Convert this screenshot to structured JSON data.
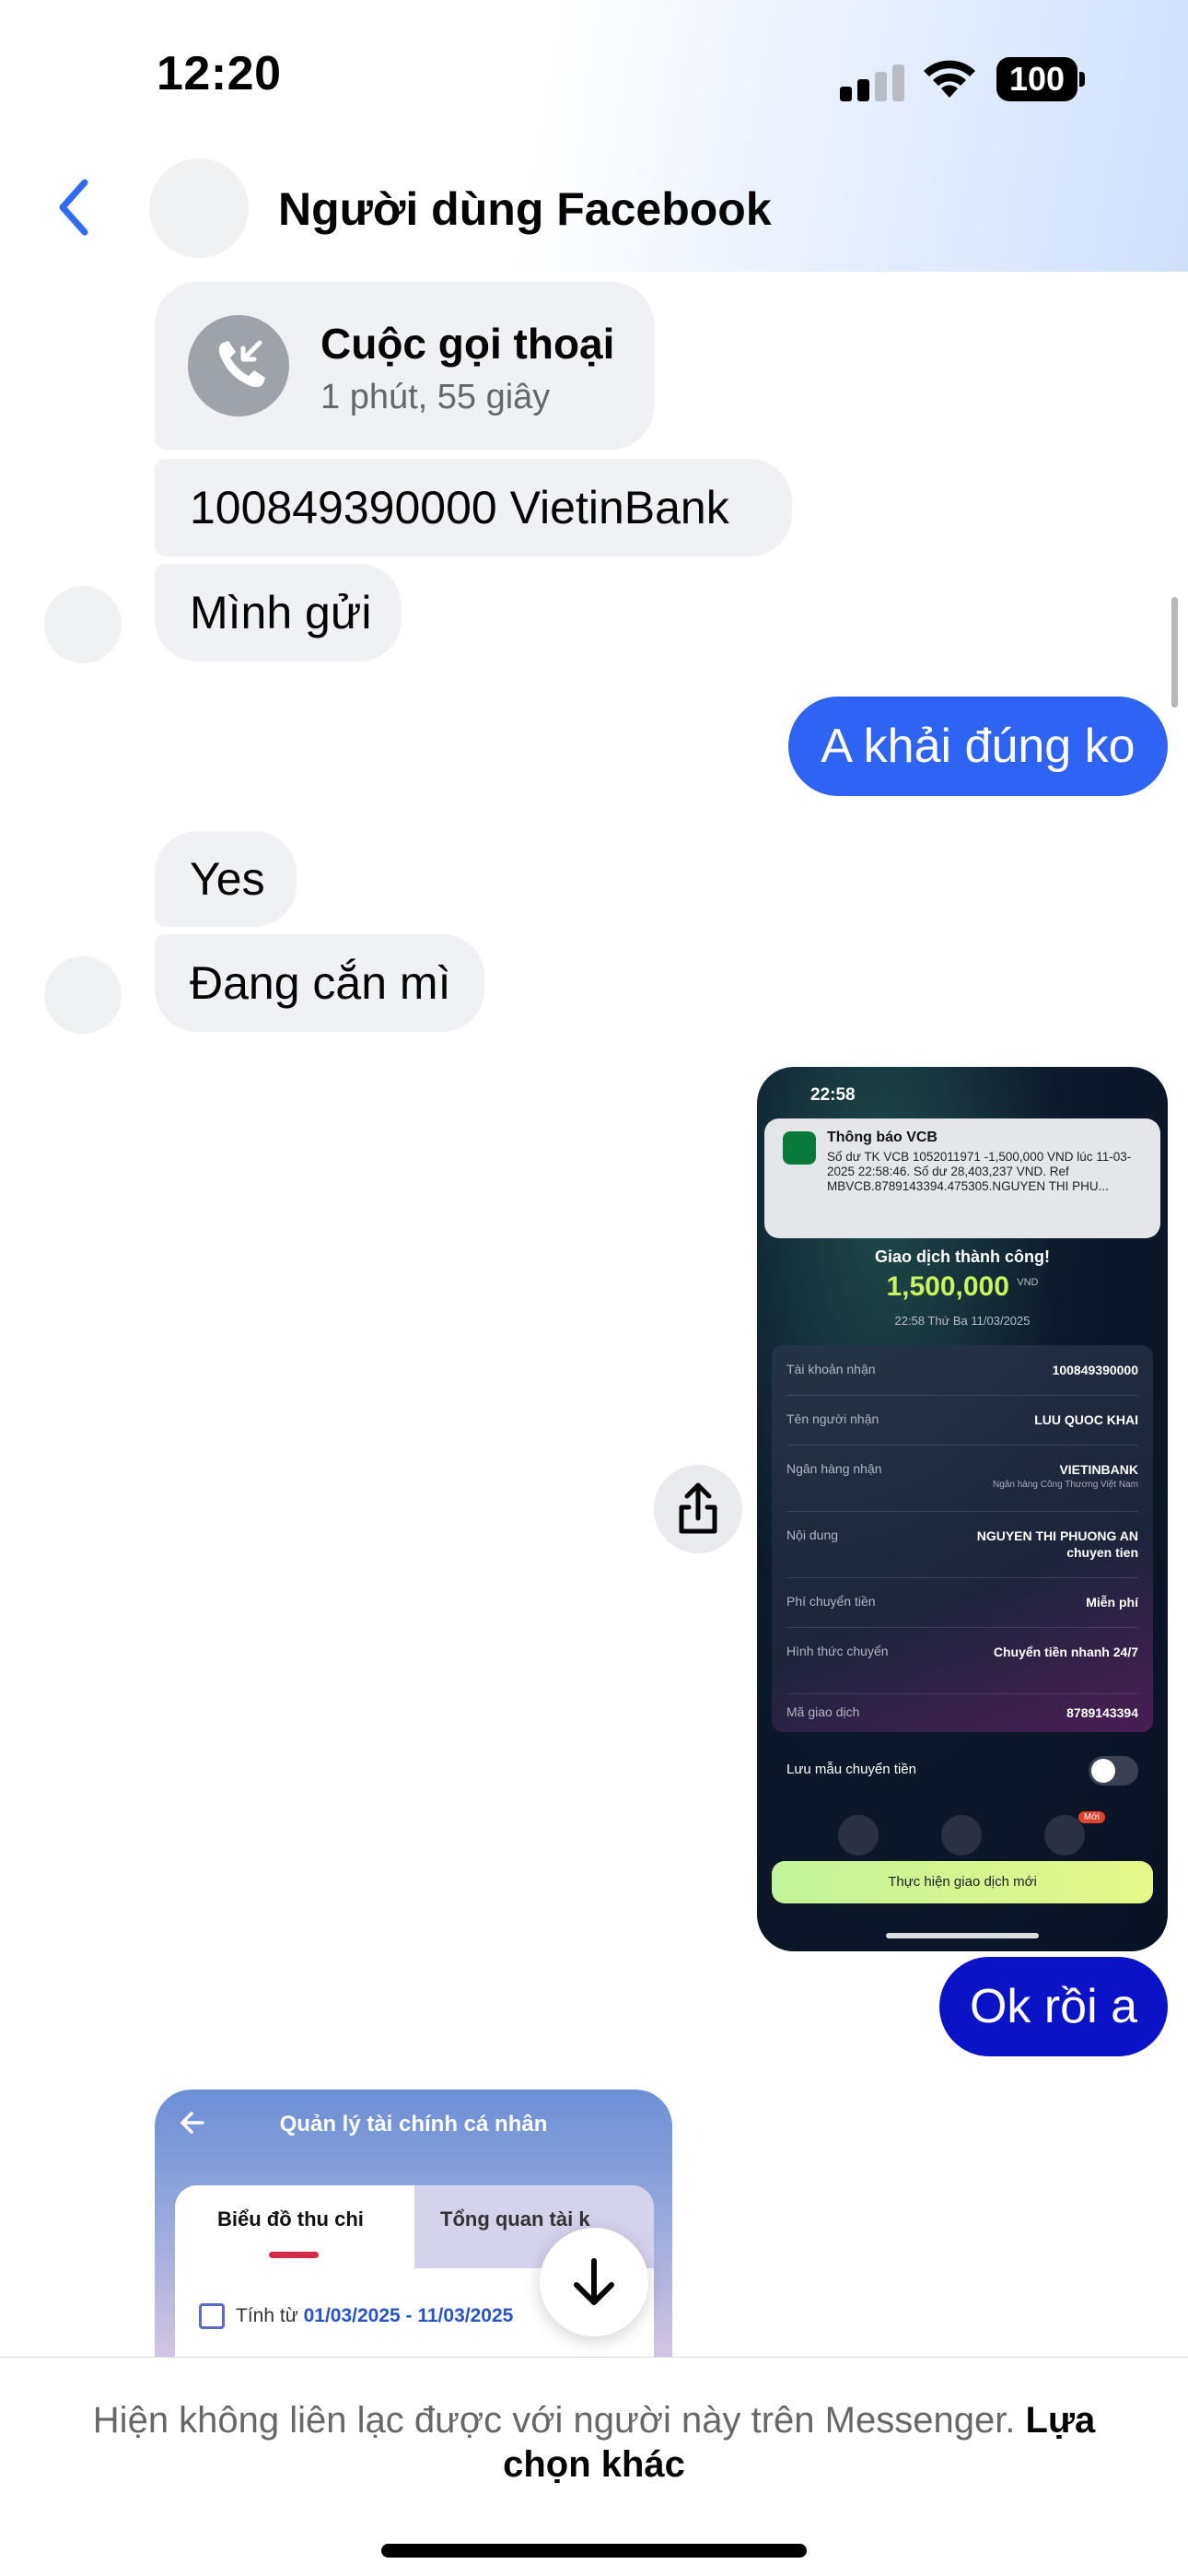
{
  "status_bar": {
    "time": "12:20",
    "battery": "100"
  },
  "header": {
    "title": "Người dùng Facebook"
  },
  "messages": {
    "call_title": "Cuộc gọi thoại",
    "call_duration": "1 phút, 55 giây",
    "account": "100849390000 VietinBank",
    "minh_gui": "Mình gửi",
    "a_khai": "A khải đúng ko",
    "yes": "Yes",
    "dang_can": "Đang cắn mì",
    "ok_roi": "Ok rồi a"
  },
  "shared_receipt": {
    "time": "22:58",
    "notif_title": "Thông báo VCB",
    "notif_body": "Số dư TK VCB 1052011971 -1,500,000 VND lúc 11-03-2025 22:58:46. Số dư 28,403,237 VND. Ref MBVCB.8789143394.475305.NGUYEN THI PHU...",
    "success": "Giao dịch thành công!",
    "amount": "1,500,000",
    "currency": "VND",
    "datetime": "22:58 Thứ Ba 11/03/2025",
    "rows": [
      {
        "k": "Tài khoản nhận",
        "v": "100849390000"
      },
      {
        "k": "Tên người nhận",
        "v": "LUU QUOC KHAI"
      },
      {
        "k": "Ngân hàng nhận",
        "v": "VIETINBANK",
        "v2": "Ngân hàng Công Thương Việt Nam"
      },
      {
        "k": "Nội dung",
        "v": "NGUYEN THI PHUONG AN chuyen tien"
      },
      {
        "k": "Phí chuyển tiền",
        "v": "Miễn phí"
      },
      {
        "k": "Hình thức chuyển",
        "v": "Chuyển tiền nhanh 24/7"
      },
      {
        "k": "Mã giao dịch",
        "v": "8789143394"
      }
    ],
    "save_template": "Lưu mẫu chuyển tiền",
    "new_badge": "Mới",
    "new_tx_button": "Thực hiện giao dịch mới"
  },
  "shared_finance": {
    "title": "Quản lý tài chính cá nhân",
    "tab1": "Biểu đồ thu chi",
    "tab2": "Tổng quan tài k",
    "range_label": "Tính từ",
    "range_value": "01/03/2025 - 11/03/2025"
  },
  "footer": {
    "text": "Hiện không liên lạc được với người này trên Messenger.",
    "link": "Lựa chọn khác"
  },
  "colors": {
    "outgoing": "#2e63f4",
    "outgoing_dark": "#0a13c6",
    "incoming": "#f0f1f4",
    "back_arrow": "#2e6bf2"
  }
}
